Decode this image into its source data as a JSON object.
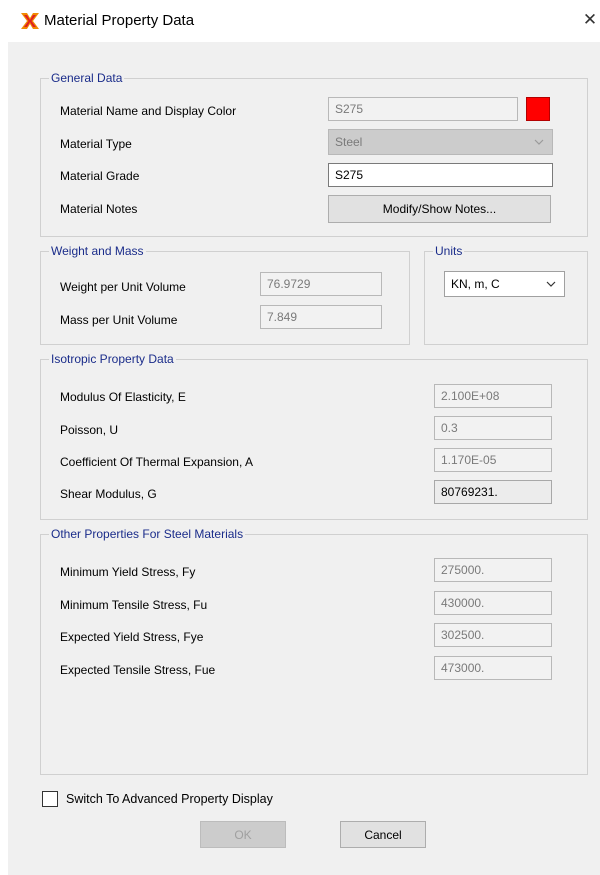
{
  "window": {
    "title": "Material Property Data",
    "close_glyph": "✕"
  },
  "general": {
    "legend": "General Data",
    "name_label": "Material Name and Display Color",
    "name_value": "S275",
    "display_color": "#ff0000",
    "type_label": "Material Type",
    "type_value": "Steel",
    "grade_label": "Material Grade",
    "grade_value": "S275",
    "notes_label": "Material Notes",
    "notes_button": "Modify/Show Notes..."
  },
  "weight": {
    "legend": "Weight and Mass",
    "weight_label": "Weight per Unit Volume",
    "weight_value": "76.9729",
    "mass_label": "Mass per Unit Volume",
    "mass_value": "7.849"
  },
  "units": {
    "legend": "Units",
    "value": "KN, m, C"
  },
  "isotropic": {
    "legend": "Isotropic Property Data",
    "e_label": "Modulus Of Elasticity,  E",
    "e_value": "2.100E+08",
    "u_label": "Poisson,  U",
    "u_value": "0.3",
    "a_label": "Coefficient Of Thermal Expansion,  A",
    "a_value": "1.170E-05",
    "g_label": "Shear Modulus,  G",
    "g_value": "80769231."
  },
  "steel": {
    "legend": "Other Properties For Steel Materials",
    "fy_label": "Minimum Yield Stress, Fy",
    "fy_value": "275000.",
    "fu_label": "Minimum Tensile Stress, Fu",
    "fu_value": "430000.",
    "fye_label": "Expected Yield Stress, Fye",
    "fye_value": "302500.",
    "fue_label": "Expected Tensile Stress, Fue",
    "fue_value": "473000."
  },
  "advanced": {
    "label": "Switch To Advanced Property Display",
    "checked": false
  },
  "buttons": {
    "ok": "OK",
    "cancel": "Cancel"
  },
  "colors": {
    "legend": "#1a2c8a",
    "client_bg": "#f0f0f0",
    "swatch": "#ff0000"
  },
  "icons": {
    "app": "sap2000-x-icon",
    "close": "close-icon",
    "dropdown": "chevron-down-icon"
  }
}
